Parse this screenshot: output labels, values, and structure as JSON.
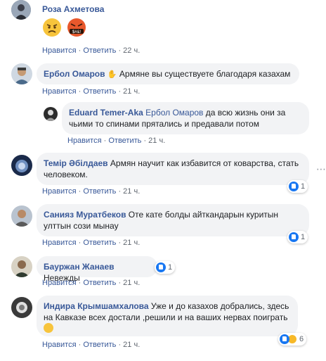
{
  "comments": [
    {
      "author": "Роза Ахметова",
      "text": "",
      "like": "Нравится",
      "sep": "·",
      "reply": "Ответить",
      "time": "22 ч.",
      "stickers": [
        "angry-face-emoji",
        "swearing-face-emoji"
      ]
    },
    {
      "author": "Ербол Омаров",
      "text": "Армяне вы существуете благодаря казахам",
      "like": "Нравится",
      "sep": "·",
      "reply": "Ответить",
      "time": "21 ч."
    },
    {
      "author": "Eduard Temer-Aka",
      "mention": "Ербол Омаров",
      "text": "да всю жизнь они за чьими то спинами прятались и предавали потом",
      "like": "Нравится",
      "sep": "·",
      "reply": "Ответить",
      "time": "21 ч."
    },
    {
      "author": "Темір Әбілдаев",
      "text": "Армян научит как избавится от коварства, стать человеком.",
      "like": "Нравится",
      "sep": "·",
      "reply": "Ответить",
      "time": "21 ч.",
      "reactions": "1"
    },
    {
      "author": "Санияз Муратбеков",
      "text": "Оте кате болды айткандарын куритын улттын сози мынау",
      "like": "Нравится",
      "sep": "·",
      "reply": "Ответить",
      "time": "21 ч.",
      "reactions": "1"
    },
    {
      "author": "Бауржан Жанаев",
      "text": "Невежды",
      "like": "Нравится",
      "sep": "·",
      "reply": "Ответить",
      "time": "21 ч.",
      "reactions": "1"
    },
    {
      "author": "Индира Крымшамхалова",
      "text": "Уже и до казахов добрались, здесь на Кавказе всех достали ,решили и на ваших нервах поиграть",
      "like": "Нравится",
      "sep": "·",
      "reply": "Ответить",
      "time": "21 ч.",
      "reactions": "6"
    }
  ],
  "colors": {
    "link": "#385898",
    "bubble": "#f2f3f5",
    "meta": "#606770",
    "like": "#1877f2"
  }
}
